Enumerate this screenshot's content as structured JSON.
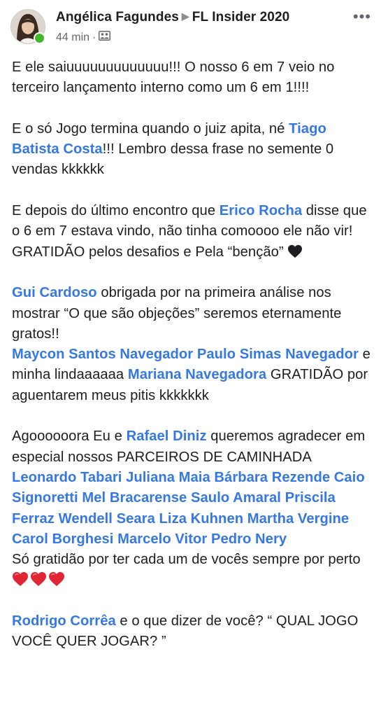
{
  "header": {
    "author": "Angélica Fagundes",
    "arrow": "▶",
    "group": "FL Insider 2020",
    "time": "44 min",
    "separator": "·",
    "more": "•••"
  },
  "post": {
    "p1": {
      "t1": "E ele saiuuuuuuuuuuuuu!!! O nosso 6 em 7 veio no terceiro lançamento interno como um 6 em 1!!!!"
    },
    "p2": {
      "t1": "E o só Jogo termina quando o juiz apita, né ",
      "m1": "Tiago Batista Costa",
      "t2": "!!! Lembro dessa frase no semente 0 vendas kkkkkk"
    },
    "p3": {
      "t1": "E depois do último encontro que ",
      "m1": "Erico Rocha",
      "t2": " disse que o 6 em 7 estava vindo, não tinha comoooo ele não vir! GRATIDÃO pelos desafios e Pela “benção” "
    },
    "p4": {
      "m1": "Gui Cardoso",
      "t1": " obrigada por na primeira análise nos mostrar “O que são objeções” seremos eternamente gratos!!",
      "m2": "Maycon Santos Navegador",
      "m3": "Paulo Simas Navegador",
      "t2": " e minha lindaaaaaa ",
      "m4": "Mariana Navegadora",
      "t3": " GRATIDÃO por aguentarem meus pitis kkkkkkk"
    },
    "p5": {
      "t1": "Agoooooora Eu e ",
      "m1": "Rafael Diniz",
      "t2": " queremos agradecer em especial nossos PARCEIROS DE CAMINHADA ",
      "m2": "Leonardo Tabari",
      "m3": "Juliana Maia",
      "m4": "Bárbara Rezende",
      "m5": "Caio Signoretti",
      "m6": "Mel Bracarense",
      "m7": "Saulo Amaral",
      "m8": "Priscila Ferraz",
      "m9": "Wendell Seara",
      "m10": "Liza Kuhnen",
      "m11": "Martha Vergine",
      "m12": "Carol Borghesi",
      "m13": "Marcelo Vitor",
      "m14": "Pedro Nery",
      "t3": "Só gratidão por ter cada um de vocês sempre por perto "
    },
    "p6": {
      "m1": "Rodrigo Corrêa",
      "t1": " e o que dizer de você? “ QUAL JOGO VOCÊ QUER JOGAR? ”"
    }
  },
  "colors": {
    "link": "#3578e5",
    "text": "#1c1e21",
    "meta": "#65676b",
    "online": "#42b72a",
    "heart_red": "#e02535",
    "heart_black": "#1c1e21"
  },
  "icons": [
    "avatar",
    "online-status-icon",
    "group-privacy-icon",
    "more-options-icon",
    "black-heart-icon",
    "red-heart-icon"
  ]
}
